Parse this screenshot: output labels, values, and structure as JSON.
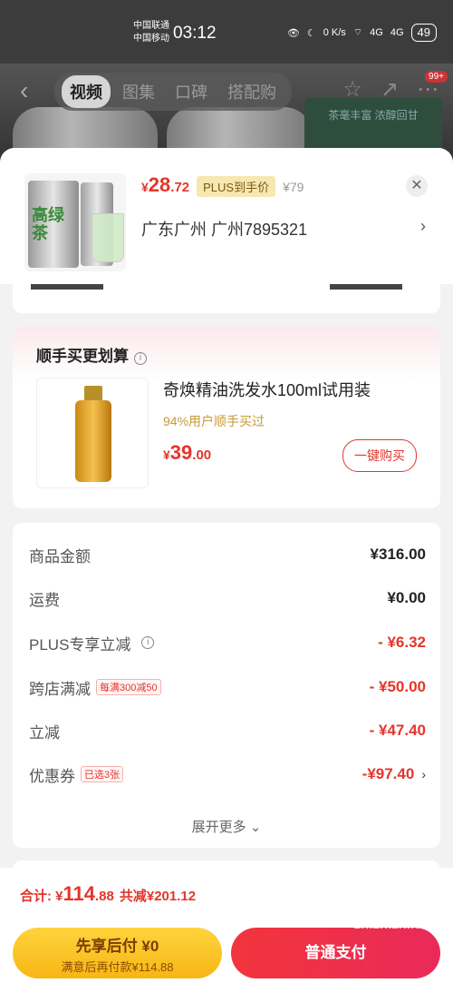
{
  "status_bar": {
    "carrier1": "中国联通",
    "carrier2": "中国移动",
    "time": "03:12",
    "net_speed": "0 K/s",
    "signal1": "4G",
    "signal2": "4G",
    "battery": "49"
  },
  "background_page": {
    "tabs": [
      "视频",
      "图集",
      "口碑",
      "搭配购"
    ],
    "active_tab": "视频",
    "badge": "99+",
    "ad_text": "茶毫丰富 浓醇回甘"
  },
  "sheet": {
    "product": {
      "image_text": "高绿茶",
      "price_symbol": "¥",
      "price_int": "28",
      "price_dec": ".72",
      "plus_tag": "PLUS到手价",
      "orig_price": "¥79",
      "address": "广东广州  广州7895321"
    },
    "addon": {
      "title": "顺手买更划算",
      "name": "奇焕精油洗发水100ml试用装",
      "sub": "94%用户顺手买过",
      "price_symbol": "¥",
      "price_int": "39",
      "price_dec": ".00",
      "buy_label": "一键购买"
    },
    "summary": {
      "rows": [
        {
          "label": "商品金额",
          "tag": "",
          "value": "¥316.00",
          "red": false
        },
        {
          "label": "运费",
          "tag": "",
          "value": "¥0.00",
          "red": false
        },
        {
          "label": "PLUS专享立减",
          "tag": "",
          "value": "- ¥6.32",
          "red": true
        },
        {
          "label": "跨店满减",
          "tag": "每满300减50",
          "value": "- ¥50.00",
          "red": true
        },
        {
          "label": "立减",
          "tag": "",
          "value": "- ¥47.40",
          "red": true
        },
        {
          "label": "优惠券",
          "tag": "已选3张",
          "value": "-¥97.40",
          "red": true
        }
      ],
      "more_label": "展开更多"
    }
  },
  "bottom_bar": {
    "total_label": "合计:",
    "total_symbol": "¥",
    "total_int": "114",
    "total_dec": ".88",
    "saved": "共减¥201.12",
    "later_title": "先享后付 ¥0",
    "later_sub": "满意后再付款¥114.88",
    "pay_label": "普通支付"
  },
  "watermark": "zhizhizhi.com"
}
